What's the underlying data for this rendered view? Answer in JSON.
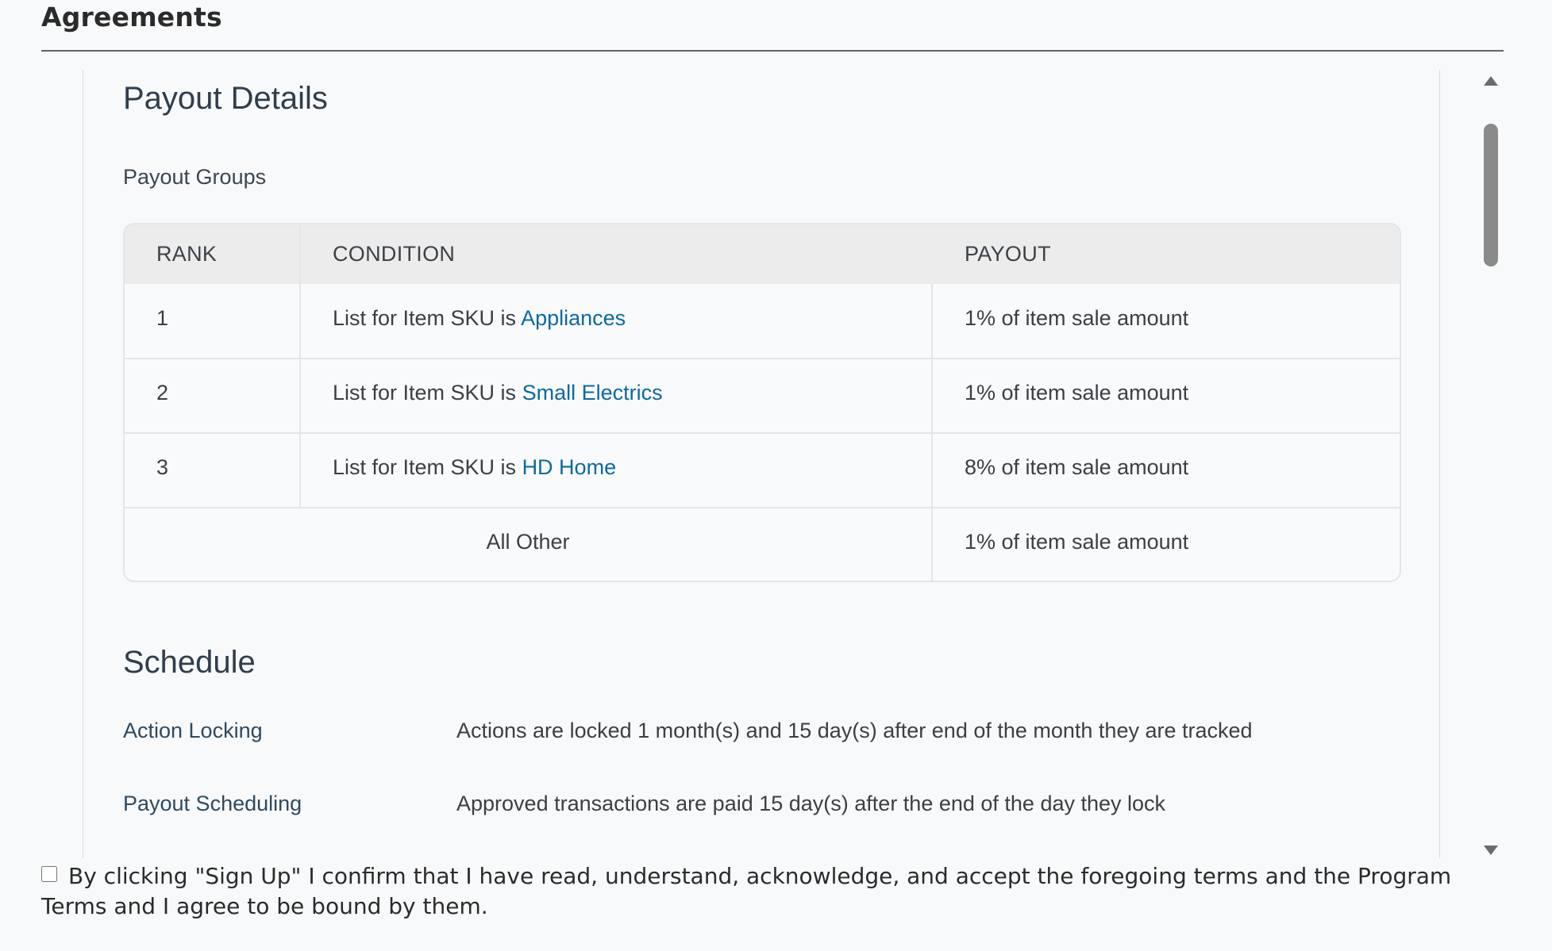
{
  "section": {
    "title": "Agreements"
  },
  "payout": {
    "heading": "Payout Details",
    "groups_label": "Payout Groups",
    "table": {
      "headers": {
        "rank": "RANK",
        "condition": "CONDITION",
        "payout": "PAYOUT"
      },
      "rows": [
        {
          "rank": "1",
          "condition_prefix": "List for Item SKU is ",
          "condition_link": "Appliances",
          "payout": "1% of item sale amount"
        },
        {
          "rank": "2",
          "condition_prefix": "List for Item SKU is ",
          "condition_link": "Small Electrics",
          "payout": "1% of item sale amount"
        },
        {
          "rank": "3",
          "condition_prefix": "List for Item SKU is ",
          "condition_link": "HD Home",
          "payout": "8% of item sale amount"
        }
      ],
      "other_row": {
        "label": "All Other",
        "payout": "1% of item sale amount"
      }
    }
  },
  "schedule": {
    "heading": "Schedule",
    "items": [
      {
        "label": "Action Locking",
        "value": "Actions are locked 1 month(s) and 15 day(s) after end of the month they are tracked"
      },
      {
        "label": "Payout Scheduling",
        "value": "Approved transactions are paid 15 day(s) after the end of the day they lock"
      }
    ]
  },
  "consent": {
    "checked": false,
    "text": "By clicking \"Sign Up\" I confirm that I have read, understand, acknowledge, and accept the foregoing terms and the Program Terms and I agree to be bound by them."
  },
  "colors": {
    "link": "#0a6aa1",
    "header_bg": "#ececec",
    "border": "#e3e6e9"
  }
}
